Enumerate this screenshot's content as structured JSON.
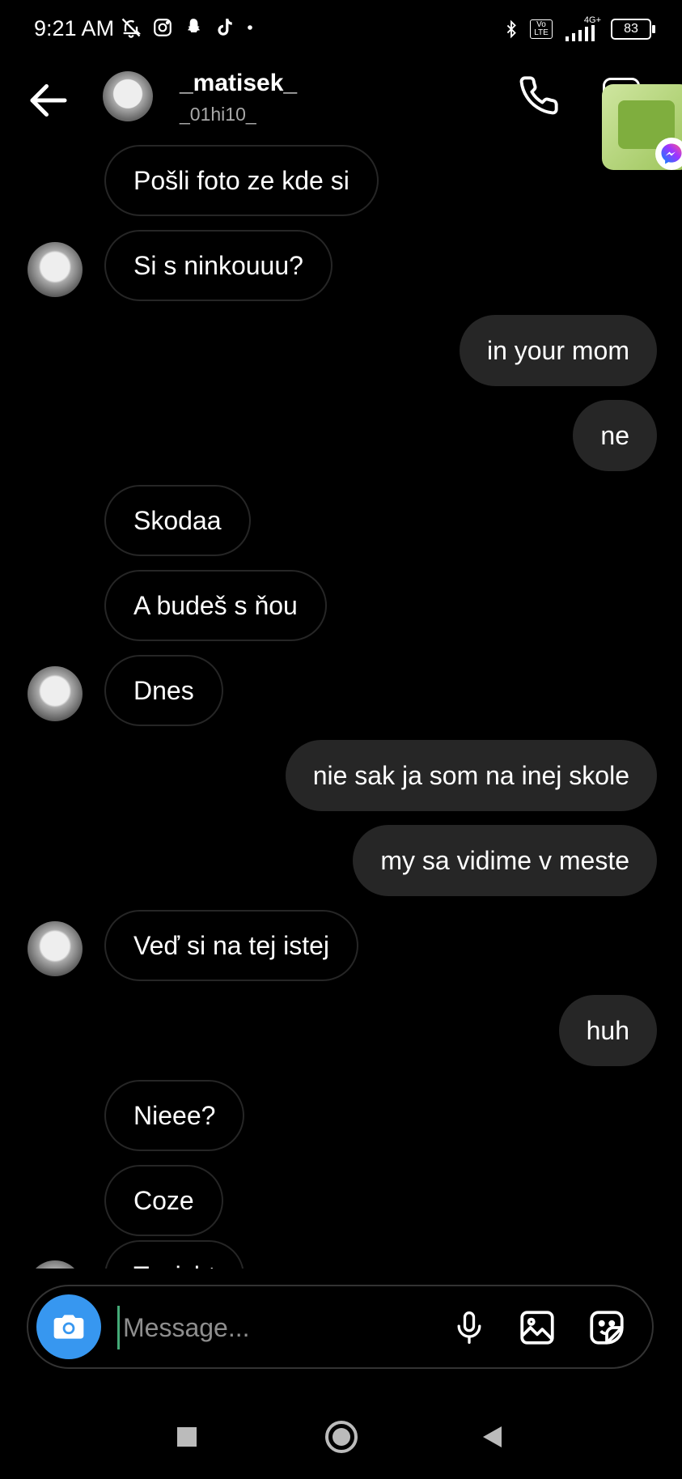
{
  "status_bar": {
    "time": "9:21 AM",
    "left_icons": [
      "bell-off-icon",
      "instagram-icon",
      "snapchat-icon",
      "tiktok-icon",
      "dot-icon"
    ],
    "network": "4G+",
    "volte": "Vo LTE",
    "battery": "83"
  },
  "header": {
    "username": "_matisek_",
    "handle": "_01hi10_"
  },
  "messages": [
    {
      "side": "in",
      "text": "Pošli foto ze kde si"
    },
    {
      "side": "in",
      "text": "Si s ninkouuu?"
    },
    {
      "side": "out",
      "text": "in your mom"
    },
    {
      "side": "out",
      "text": "ne"
    },
    {
      "side": "in",
      "text": "Skodaa"
    },
    {
      "side": "in",
      "text": "A budeš s ňou"
    },
    {
      "side": "in",
      "text": "Dnes"
    },
    {
      "side": "out",
      "text": "nie sak ja som na inej skole"
    },
    {
      "side": "out",
      "text": "my sa vidime v meste"
    },
    {
      "side": "in",
      "text": "Veď si na tej istej"
    },
    {
      "side": "out",
      "text": "huh"
    },
    {
      "side": "in",
      "text": "Nieee?"
    },
    {
      "side": "in",
      "text": "Coze"
    },
    {
      "side": "in",
      "text": "Tonicht"
    }
  ],
  "composer": {
    "placeholder": "Message..."
  },
  "colors": {
    "background": "#000000",
    "outgoing_bubble": "#262626",
    "incoming_border": "#262626",
    "camera_button": "#3797f0",
    "secondary_text": "#a8a8a8"
  }
}
